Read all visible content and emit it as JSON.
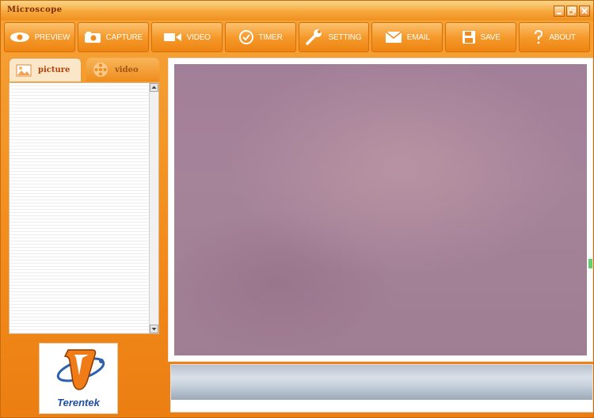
{
  "window": {
    "title": "Microscope"
  },
  "titlebar_buttons": [
    "minimize",
    "restore",
    "close"
  ],
  "toolbar": [
    {
      "key": "preview",
      "label": "PREVIEW",
      "icon": "eye-icon"
    },
    {
      "key": "capture",
      "label": "CAPTURE",
      "icon": "camera-icon"
    },
    {
      "key": "video",
      "label": "VIDEO",
      "icon": "video-camera-icon"
    },
    {
      "key": "timer",
      "label": "TIMER",
      "icon": "clock-icon"
    },
    {
      "key": "setting",
      "label": "SETTING",
      "icon": "wrench-icon"
    },
    {
      "key": "email",
      "label": "EMAIL",
      "icon": "envelope-icon"
    },
    {
      "key": "save",
      "label": "SAVE",
      "icon": "floppy-disk-icon"
    },
    {
      "key": "about",
      "label": "ABOUT",
      "icon": "question-mark-icon"
    }
  ],
  "tabs": [
    {
      "label": "picture",
      "icon": "picture-icon",
      "active": true
    },
    {
      "label": "video",
      "icon": "film-reel-icon",
      "active": false
    }
  ],
  "logo": {
    "brand": "Terentek"
  },
  "colors": {
    "frame_orange": "#f28b1c",
    "title_text": "#7a2d00",
    "logo_blue": "#1d4ea0",
    "preview_mauve": "#a27f98"
  }
}
